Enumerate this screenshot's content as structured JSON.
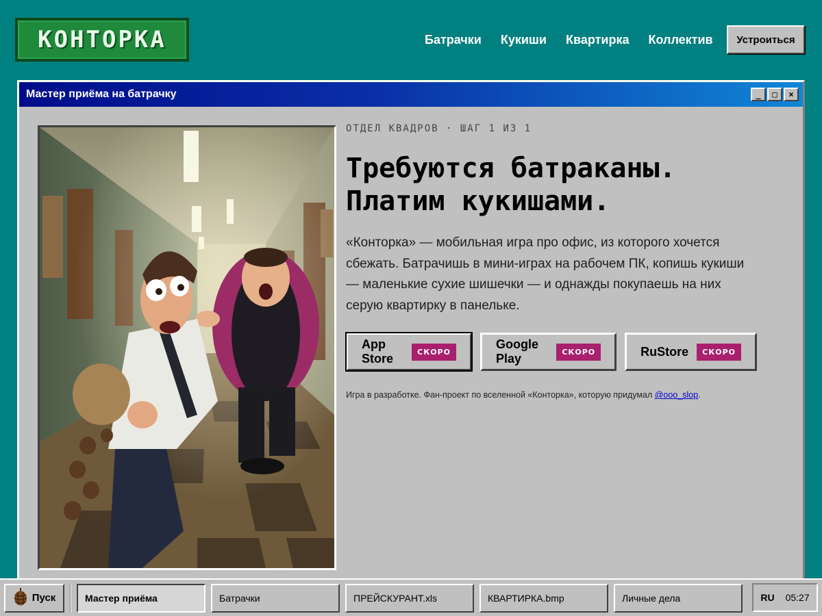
{
  "header": {
    "logo_text": "КОНТОРКА",
    "nav": [
      "Батрачки",
      "Кукиши",
      "Квартирка",
      "Коллектив"
    ],
    "cta_label": "Устроиться"
  },
  "window": {
    "title": "Мастер приёма на батрачку",
    "controls": [
      "_",
      "□",
      "×"
    ]
  },
  "content": {
    "kicker": "ОТДЕЛ КВАДРОВ · ШАГ 1 ИЗ 1",
    "headline_line1": "Требуются батраканы.",
    "headline_line2": "Платим кукишами.",
    "description": "«Конторка» — мобильная игра про офис, из которого хочется сбежать. Батрачишь в мини-играх на рабочем ПК, копишь кукиши — маленькие сухие шишечки — и однажды покупаешь на них серую квартирку в панельке.",
    "stores": [
      {
        "label": "App Store",
        "badge": "СКОРО"
      },
      {
        "label": "Google Play",
        "badge": "СКОРО"
      },
      {
        "label": "RuStore",
        "badge": "СКОРО"
      }
    ],
    "footnote_text": "Игра в разработке. Фан-проект по вселенной «Конторка», которую придумал ",
    "footnote_link": "@ooo_slop",
    "footnote_end": "."
  },
  "taskbar": {
    "start_label": "Пуск",
    "tasks": [
      "Мастер приёма",
      "Батрачки",
      "ПРЕЙСКУРАНТ.xls",
      "КВАРТИРКА.bmp",
      "Личные дела"
    ],
    "lang": "RU",
    "time": "05:27"
  },
  "colors": {
    "desktop": "#008080",
    "window_face": "#c0c0c0",
    "titlebar_start": "#000c8a",
    "titlebar_end": "#1086d6",
    "badge": "#a8206e",
    "logo_green": "#1f8a3c"
  },
  "icons": {
    "start": "pinecone-icon",
    "minimize": "minimize-icon",
    "maximize": "maximize-icon",
    "close": "close-icon"
  }
}
